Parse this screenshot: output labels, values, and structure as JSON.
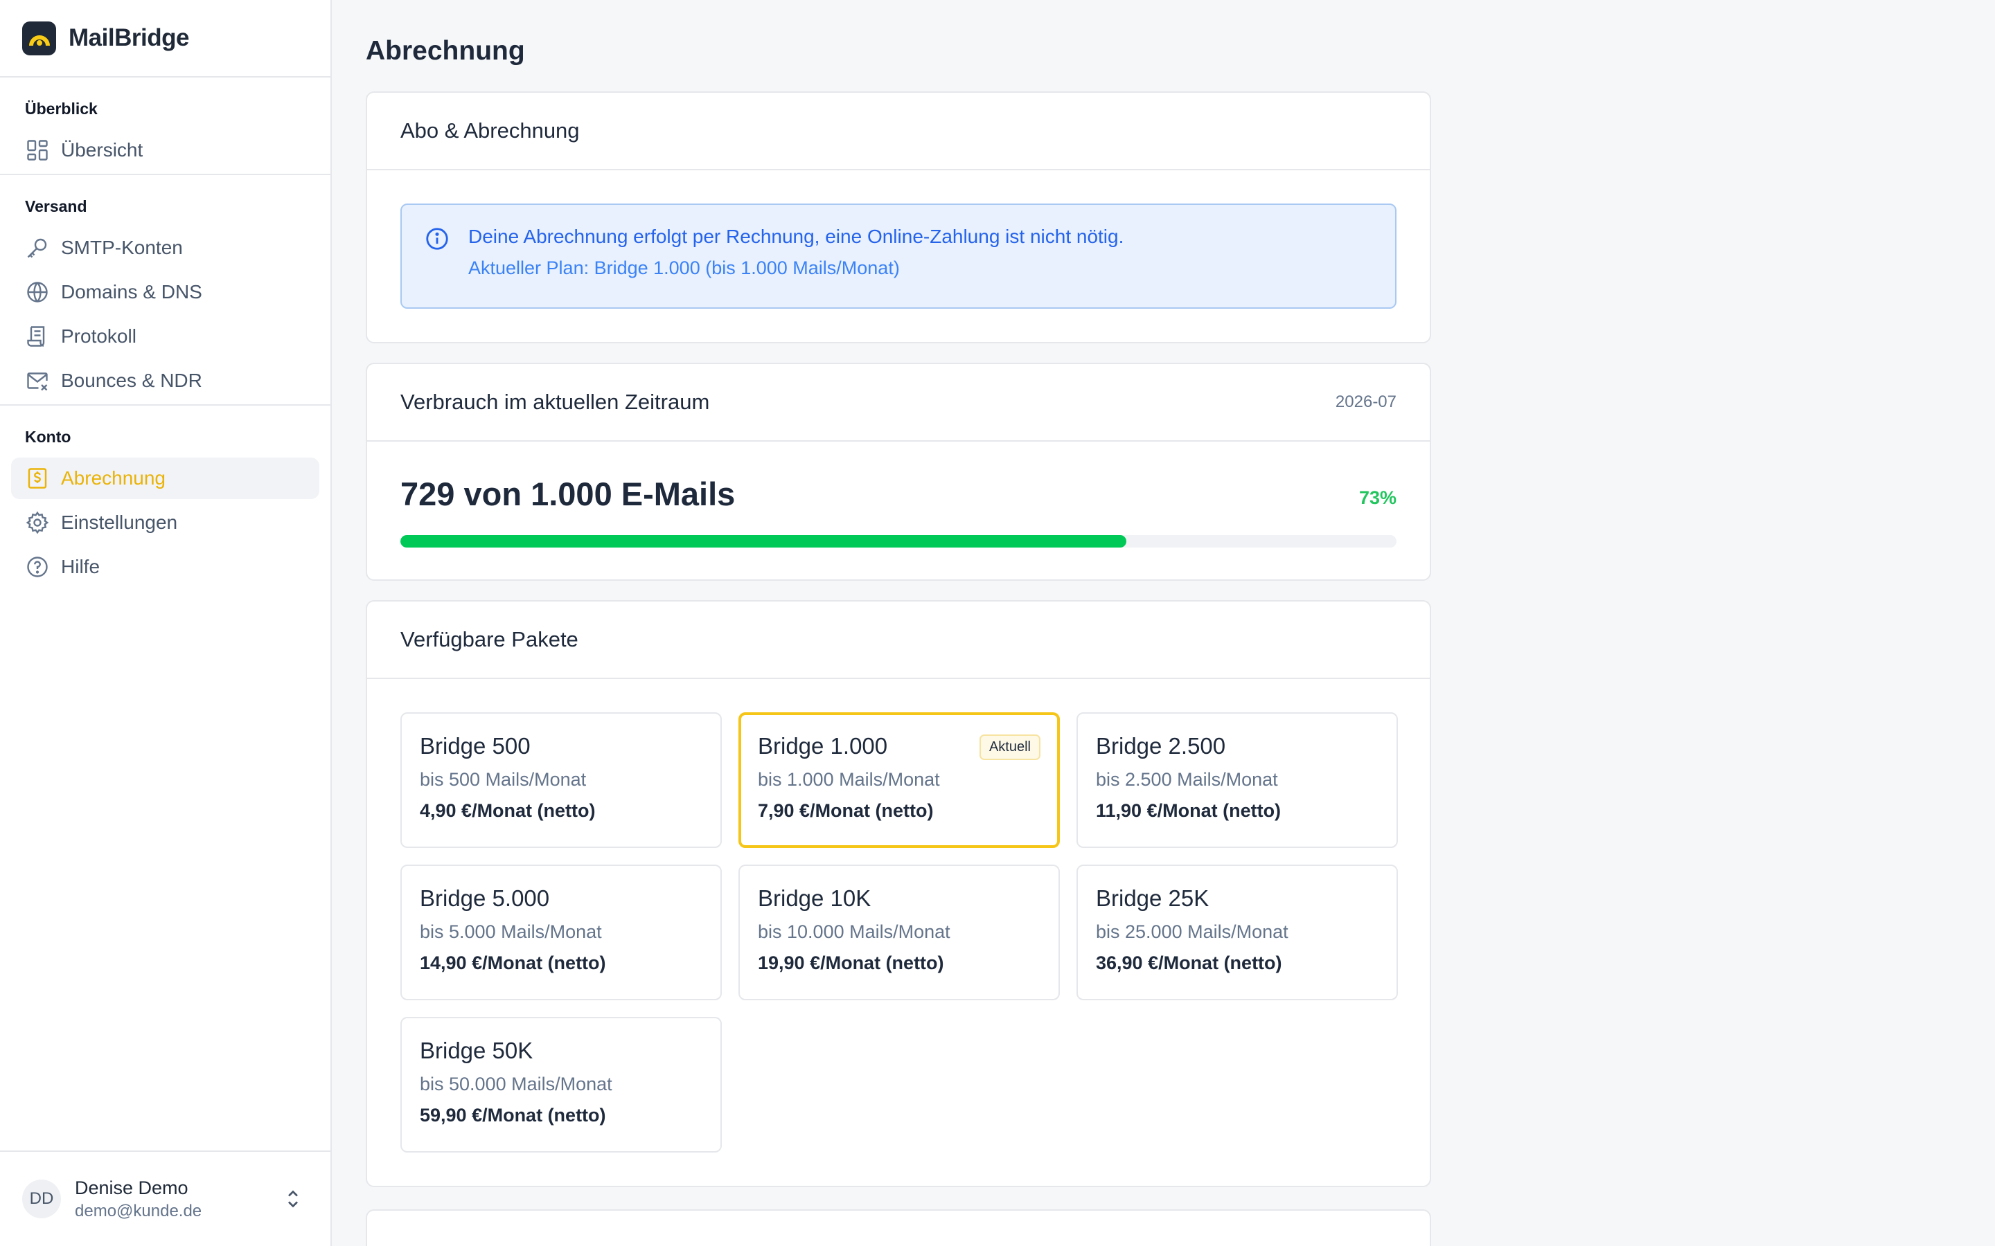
{
  "app": {
    "brand_name": "MailBridge"
  },
  "sidebar": {
    "sections": [
      {
        "heading": "Überblick",
        "items": [
          {
            "label": "Übersicht",
            "icon": "dashboard-grid-icon",
            "active": false
          }
        ]
      },
      {
        "heading": "Versand",
        "items": [
          {
            "label": "SMTP-Konten",
            "icon": "key-icon",
            "active": false
          },
          {
            "label": "Domains & DNS",
            "icon": "globe-icon",
            "active": false
          },
          {
            "label": "Protokoll",
            "icon": "scroll-icon",
            "active": false
          },
          {
            "label": "Bounces & NDR",
            "icon": "mail-x-icon",
            "active": false
          }
        ]
      },
      {
        "heading": "Konto",
        "items": [
          {
            "label": "Abrechnung",
            "icon": "dollar-receipt-icon",
            "active": true
          },
          {
            "label": "Einstellungen",
            "icon": "gear-icon",
            "active": false
          },
          {
            "label": "Hilfe",
            "icon": "help-circle-icon",
            "active": false
          }
        ]
      }
    ],
    "user": {
      "initials": "DD",
      "name": "Denise Demo",
      "email": "demo@kunde.de"
    }
  },
  "main": {
    "page_title": "Abrechnung",
    "billing_card": {
      "title": "Abo & Abrechnung",
      "alert_line1": "Deine Abrechnung erfolgt per Rechnung, eine Online-Zahlung ist nicht nötig.",
      "alert_line2": "Aktueller Plan: Bridge 1.000 (bis 1.000 Mails/Monat)"
    },
    "usage_card": {
      "title": "Verbrauch im aktuellen Zeitraum",
      "period": "2026-07",
      "usage_text": "729 von 1.000 E-Mails",
      "percent_label": "73%",
      "used": 729,
      "limit": 1000
    },
    "plans_card": {
      "title": "Verfügbare Pakete",
      "current_badge": "Aktuell",
      "plans": [
        {
          "name": "Bridge 500",
          "limit": "bis 500 Mails/Monat",
          "price": "4,90 €/Monat (netto)",
          "current": false
        },
        {
          "name": "Bridge 1.000",
          "limit": "bis 1.000 Mails/Monat",
          "price": "7,90 €/Monat (netto)",
          "current": true
        },
        {
          "name": "Bridge 2.500",
          "limit": "bis 2.500 Mails/Monat",
          "price": "11,90 €/Monat (netto)",
          "current": false
        },
        {
          "name": "Bridge 5.000",
          "limit": "bis 5.000 Mails/Monat",
          "price": "14,90 €/Monat (netto)",
          "current": false
        },
        {
          "name": "Bridge 10K",
          "limit": "bis 10.000 Mails/Monat",
          "price": "19,90 €/Monat (netto)",
          "current": false
        },
        {
          "name": "Bridge 25K",
          "limit": "bis 25.000 Mails/Monat",
          "price": "36,90 €/Monat (netto)",
          "current": false
        },
        {
          "name": "Bridge 50K",
          "limit": "bis 50.000 Mails/Monat",
          "price": "59,90 €/Monat (netto)",
          "current": false
        }
      ]
    }
  },
  "colors": {
    "accent": "#eab308",
    "progress": "#00c957",
    "info": "#2563eb"
  }
}
